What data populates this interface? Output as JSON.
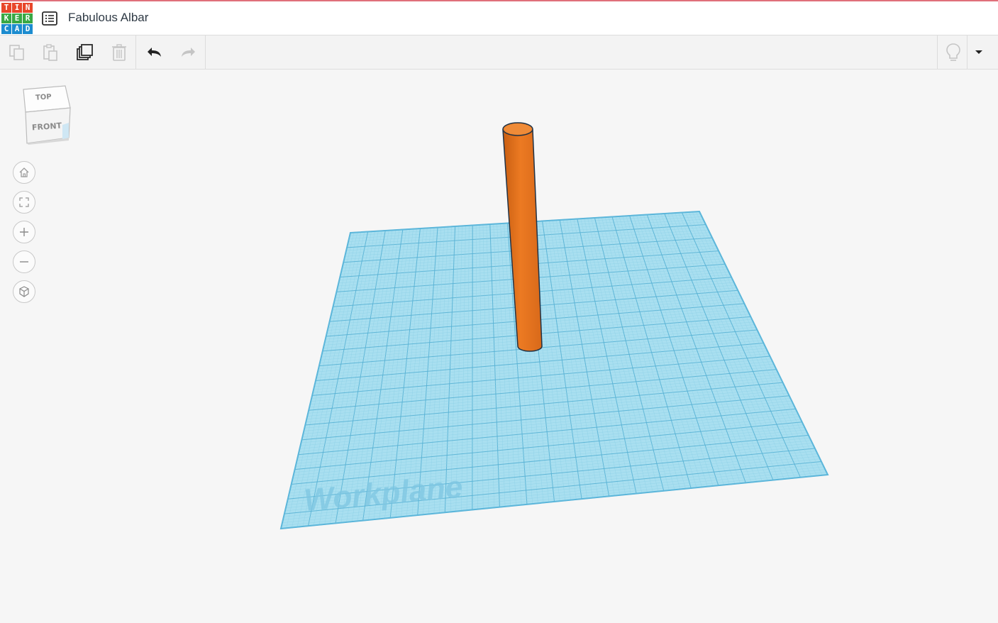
{
  "app": {
    "logo_letters": [
      "T",
      "I",
      "N",
      "K",
      "E",
      "R",
      "C",
      "A",
      "D"
    ],
    "logo_colors": [
      "#e8462a",
      "#e8462a",
      "#e8462a",
      "#39a845",
      "#39a845",
      "#39a845",
      "#1c8ccf",
      "#1c8ccf",
      "#1c8ccf"
    ],
    "design_title": "Fabulous Albar"
  },
  "toolbar": {
    "tools": [
      {
        "name": "copy",
        "enabled": false
      },
      {
        "name": "paste",
        "enabled": false
      },
      {
        "name": "duplicate",
        "enabled": true
      },
      {
        "name": "delete",
        "enabled": false
      },
      {
        "name": "undo",
        "enabled": true
      },
      {
        "name": "redo",
        "enabled": false
      }
    ],
    "right": [
      {
        "name": "hint-bulb"
      },
      {
        "name": "dropdown"
      }
    ]
  },
  "viewcube": {
    "top_label": "TOP",
    "front_label": "FRONT"
  },
  "nav_controls": [
    {
      "name": "home-view",
      "icon": "home-icon"
    },
    {
      "name": "fit-view",
      "icon": "fit-icon"
    },
    {
      "name": "zoom-in",
      "icon": "plus-icon"
    },
    {
      "name": "zoom-out",
      "icon": "minus-icon"
    },
    {
      "name": "ortho-view",
      "icon": "cube-icon"
    }
  ],
  "workplane": {
    "label": "Workplane",
    "color": "#8fd3ea",
    "grid_color": "#4aa9cf"
  },
  "shape": {
    "type": "cylinder",
    "color": "#e8731d"
  }
}
